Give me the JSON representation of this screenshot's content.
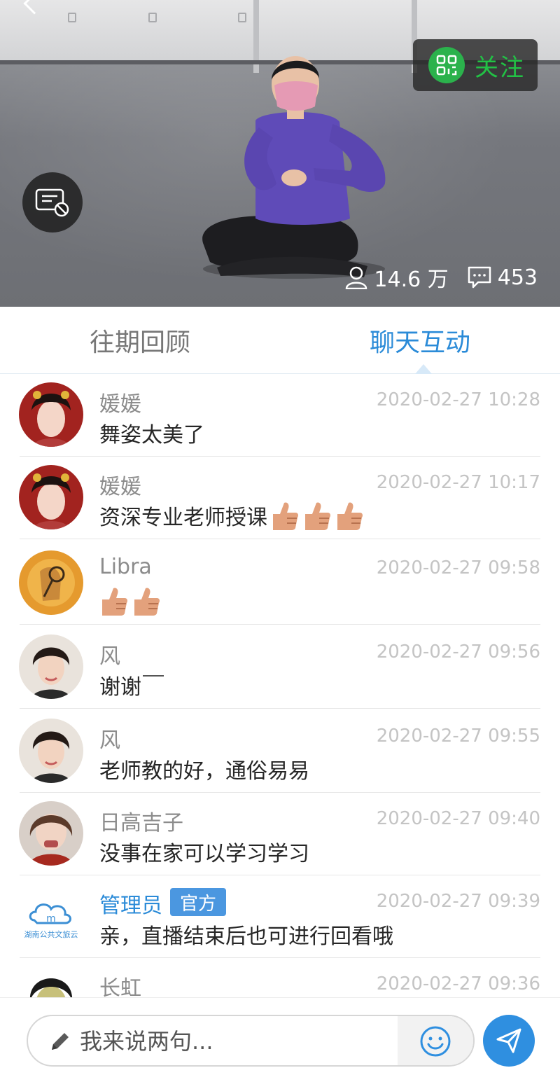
{
  "video": {
    "follow_label": "关注",
    "viewers": "14.6 万",
    "comments": "453"
  },
  "tabs": [
    {
      "label": "往期回顾",
      "active": false
    },
    {
      "label": "聊天互动",
      "active": true
    }
  ],
  "messages": [
    {
      "name": "媛媛",
      "time": "2020-02-27 10:28",
      "text": "舞姿太美了",
      "thumbs": 0,
      "avatar": "avatar-yuanyuan"
    },
    {
      "name": "媛媛",
      "time": "2020-02-27 10:17",
      "text": "资深专业老师授课",
      "thumbs": 3,
      "avatar": "avatar-yuanyuan"
    },
    {
      "name": "Libra",
      "time": "2020-02-27 09:58",
      "text": "",
      "thumbs": 2,
      "avatar": "avatar-libra"
    },
    {
      "name": "风",
      "time": "2020-02-27 09:56",
      "text": "谢谢",
      "thumbs": 0,
      "avatar": "avatar-feng"
    },
    {
      "name": "风",
      "time": "2020-02-27 09:55",
      "text": "老师教的好，通俗易易",
      "thumbs": 0,
      "avatar": "avatar-feng"
    },
    {
      "name": "日高吉子",
      "time": "2020-02-27 09:40",
      "text": "没事在家可以学习学习",
      "thumbs": 0,
      "avatar": "avatar-rigao"
    },
    {
      "name": "管理员",
      "badge": "官方",
      "time": "2020-02-27 09:39",
      "text": "亲，直播结束后也可进行回看哦",
      "thumbs": 0,
      "avatar": "avatar-admin",
      "logo_text": "湖南公共文旅云"
    },
    {
      "name": "长虹",
      "time": "2020-02-27 09:36",
      "text": "",
      "thumbs": 0,
      "avatar": "avatar-changhong"
    }
  ],
  "input": {
    "placeholder": "我来说两句..."
  },
  "colors": {
    "accent": "#2b8bd8",
    "follow_green": "#2bb24c",
    "send_blue": "#2f8fe0"
  }
}
